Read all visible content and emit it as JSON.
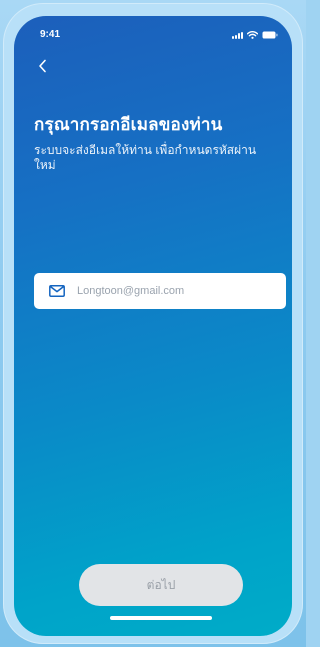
{
  "status_bar": {
    "time": "9:41",
    "icons": [
      "signal-icon",
      "wifi-icon",
      "battery-icon"
    ]
  },
  "nav": {
    "back_icon": "chevron-left-icon"
  },
  "header": {
    "title": "กรุณากรอกอีเมลของท่าน",
    "subtitle": "ระบบจะส่งอีเมลให้ท่าน เพื่อกำหนดรหัสผ่านใหม่"
  },
  "form": {
    "email_icon": "mail-icon",
    "email_value": "Longtoon@gmail.com"
  },
  "actions": {
    "next_label": "ต่อไป"
  },
  "colors": {
    "gradient_top": "#1c5fbb",
    "gradient_bottom": "#00acc8",
    "button_disabled_bg": "#e2e4e7",
    "button_disabled_text": "#9aa0a8",
    "input_text": "#9aa3ae"
  }
}
